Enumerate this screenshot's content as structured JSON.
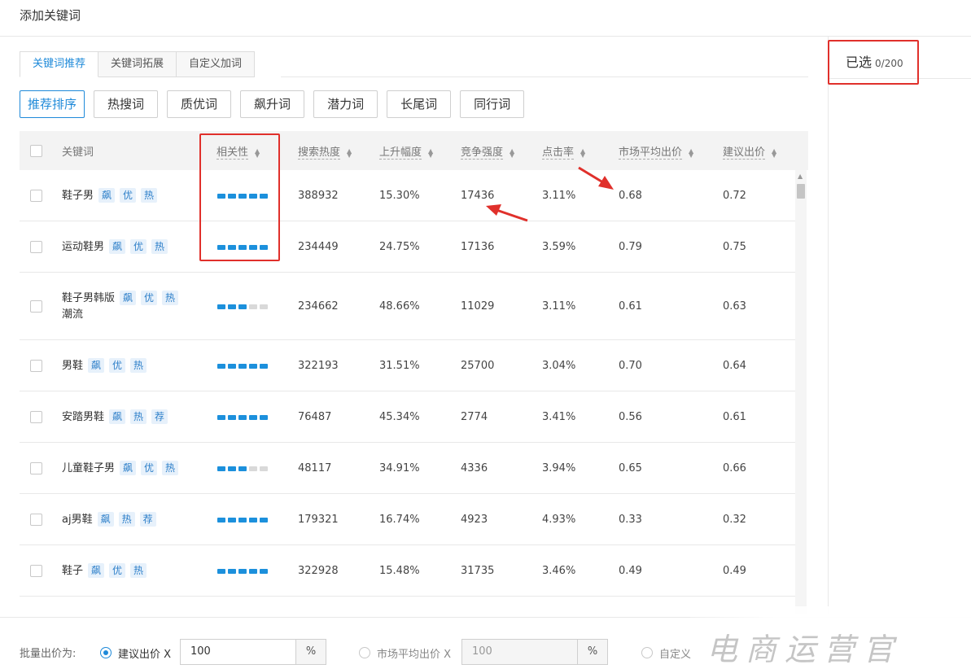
{
  "dialog": {
    "title": "添加关键词"
  },
  "selected": {
    "label": "已选",
    "count": "0/200"
  },
  "tabs": [
    "关键词推荐",
    "关键词拓展",
    "自定义加词"
  ],
  "filters": [
    "推荐排序",
    "热搜词",
    "质优词",
    "飙升词",
    "潜力词",
    "长尾词",
    "同行词"
  ],
  "table": {
    "headers": {
      "keyword": "关键词",
      "relevance": "相关性",
      "search": "搜索热度",
      "rise": "上升幅度",
      "competition": "竞争强度",
      "ctr": "点击率",
      "market_bid": "市场平均出价",
      "suggested_bid": "建议出价"
    },
    "rows": [
      {
        "keyword": [
          "鞋子男"
        ],
        "tags": [
          "飙",
          "优",
          "热"
        ],
        "relevance": 5,
        "search": "388932",
        "rise": "15.30%",
        "competition": "17436",
        "ctr": "3.11%",
        "market_bid": "0.68",
        "suggested_bid": "0.72"
      },
      {
        "keyword": [
          "运动鞋男"
        ],
        "tags": [
          "飙",
          "优",
          "热"
        ],
        "relevance": 5,
        "search": "234449",
        "rise": "24.75%",
        "competition": "17136",
        "ctr": "3.59%",
        "market_bid": "0.79",
        "suggested_bid": "0.75"
      },
      {
        "keyword": [
          "鞋子男韩版",
          "潮流"
        ],
        "tags": [
          "飙",
          "优",
          "热"
        ],
        "relevance": 3,
        "search": "234662",
        "rise": "48.66%",
        "competition": "11029",
        "ctr": "3.11%",
        "market_bid": "0.61",
        "suggested_bid": "0.63"
      },
      {
        "keyword": [
          "男鞋"
        ],
        "tags": [
          "飙",
          "优",
          "热"
        ],
        "relevance": 5,
        "search": "322193",
        "rise": "31.51%",
        "competition": "25700",
        "ctr": "3.04%",
        "market_bid": "0.70",
        "suggested_bid": "0.64"
      },
      {
        "keyword": [
          "安踏男鞋"
        ],
        "tags": [
          "飙",
          "热",
          "荐"
        ],
        "relevance": 5,
        "search": "76487",
        "rise": "45.34%",
        "competition": "2774",
        "ctr": "3.41%",
        "market_bid": "0.56",
        "suggested_bid": "0.61"
      },
      {
        "keyword": [
          "儿童鞋子男"
        ],
        "tags": [
          "飙",
          "优",
          "热"
        ],
        "relevance": 3,
        "search": "48117",
        "rise": "34.91%",
        "competition": "4336",
        "ctr": "3.94%",
        "market_bid": "0.65",
        "suggested_bid": "0.66"
      },
      {
        "keyword": [
          "aj男鞋"
        ],
        "tags": [
          "飙",
          "热",
          "荐"
        ],
        "relevance": 5,
        "search": "179321",
        "rise": "16.74%",
        "competition": "4923",
        "ctr": "4.93%",
        "market_bid": "0.33",
        "suggested_bid": "0.32"
      },
      {
        "keyword": [
          "鞋子"
        ],
        "tags": [
          "飙",
          "优",
          "热"
        ],
        "relevance": 5,
        "search": "322928",
        "rise": "15.48%",
        "competition": "31735",
        "ctr": "3.46%",
        "market_bid": "0.49",
        "suggested_bid": "0.49"
      }
    ]
  },
  "batch": {
    "label": "批量出价为:",
    "option1": "建议出价 X",
    "value1": "100",
    "unit": "%",
    "option2": "市场平均出价 X",
    "value2": "100",
    "option3": "自定义"
  },
  "watermark": "电商运营官",
  "colors": {
    "accent": "#1f8ad9",
    "annotation": "#e0302b",
    "relevance_bar": "#1c90dc"
  }
}
